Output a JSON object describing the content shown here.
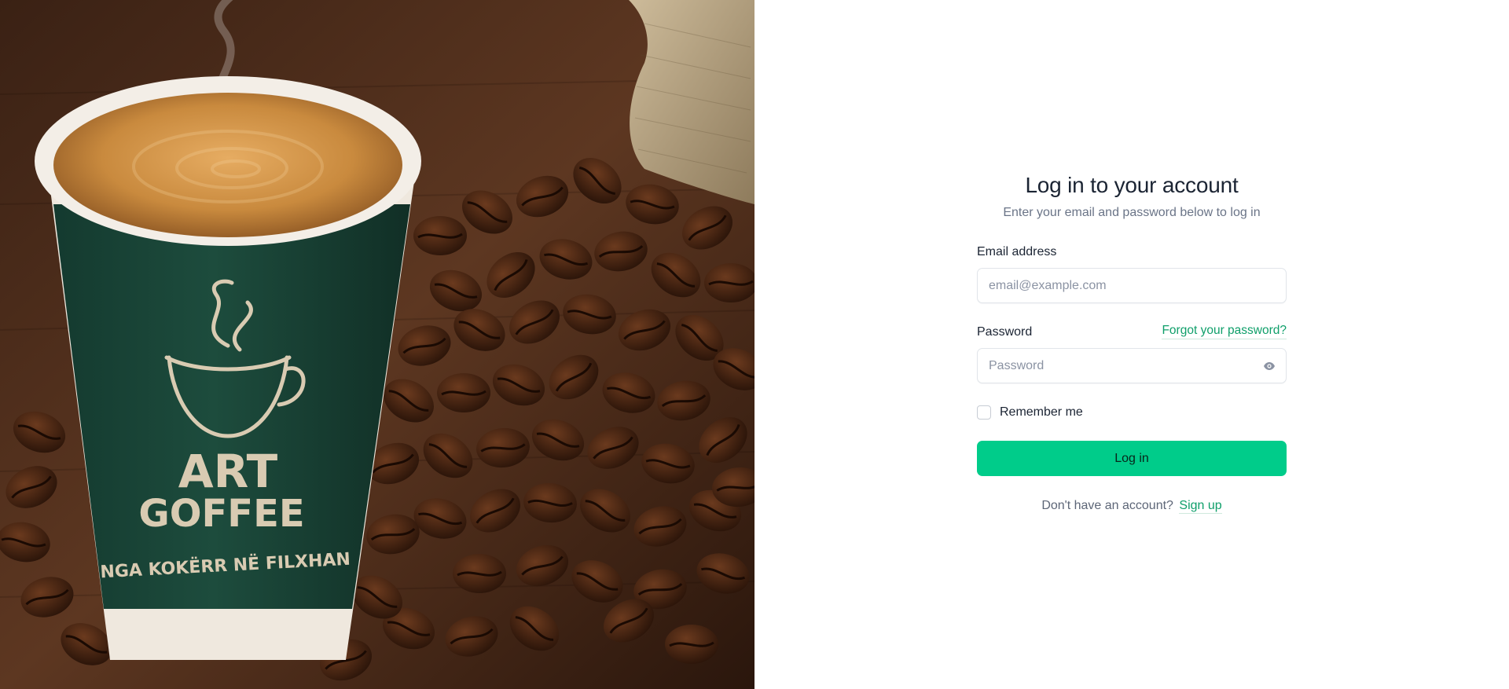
{
  "hero": {
    "brand_line1": "ART",
    "brand_line2": "GOFFEE",
    "tagline": "NGA KOKËRR NË FILXHAN",
    "colors": {
      "cup_green": "#1c4a3b",
      "coffee": "#c98a3e",
      "wood": "#5b3420",
      "bean": "#3b1f10"
    }
  },
  "form": {
    "title": "Log in to your account",
    "subtitle": "Enter your email and password below to log in",
    "email": {
      "label": "Email address",
      "placeholder": "email@example.com",
      "value": ""
    },
    "password": {
      "label": "Password",
      "placeholder": "Password",
      "value": "",
      "forgot_link": "Forgot your password?",
      "toggle_icon": "eye-icon"
    },
    "remember": {
      "label": "Remember me",
      "checked": false
    },
    "submit_label": "Log in",
    "signup_prompt": "Don't have an account?",
    "signup_link": "Sign up"
  },
  "colors": {
    "accent": "#00cc8a",
    "link": "#0f9f6a",
    "text": "#1b2433",
    "muted": "#6a7487"
  }
}
